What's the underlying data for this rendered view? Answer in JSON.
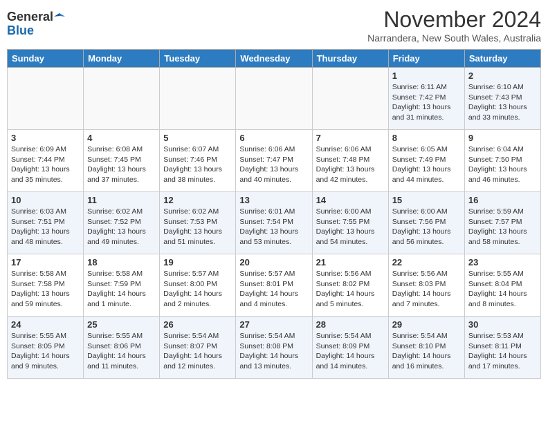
{
  "header": {
    "logo_general": "General",
    "logo_blue": "Blue",
    "month_title": "November 2024",
    "subtitle": "Narrandera, New South Wales, Australia"
  },
  "days_of_week": [
    "Sunday",
    "Monday",
    "Tuesday",
    "Wednesday",
    "Thursday",
    "Friday",
    "Saturday"
  ],
  "weeks": [
    [
      {
        "num": "",
        "detail": ""
      },
      {
        "num": "",
        "detail": ""
      },
      {
        "num": "",
        "detail": ""
      },
      {
        "num": "",
        "detail": ""
      },
      {
        "num": "",
        "detail": ""
      },
      {
        "num": "1",
        "detail": "Sunrise: 6:11 AM\nSunset: 7:42 PM\nDaylight: 13 hours\nand 31 minutes."
      },
      {
        "num": "2",
        "detail": "Sunrise: 6:10 AM\nSunset: 7:43 PM\nDaylight: 13 hours\nand 33 minutes."
      }
    ],
    [
      {
        "num": "3",
        "detail": "Sunrise: 6:09 AM\nSunset: 7:44 PM\nDaylight: 13 hours\nand 35 minutes."
      },
      {
        "num": "4",
        "detail": "Sunrise: 6:08 AM\nSunset: 7:45 PM\nDaylight: 13 hours\nand 37 minutes."
      },
      {
        "num": "5",
        "detail": "Sunrise: 6:07 AM\nSunset: 7:46 PM\nDaylight: 13 hours\nand 38 minutes."
      },
      {
        "num": "6",
        "detail": "Sunrise: 6:06 AM\nSunset: 7:47 PM\nDaylight: 13 hours\nand 40 minutes."
      },
      {
        "num": "7",
        "detail": "Sunrise: 6:06 AM\nSunset: 7:48 PM\nDaylight: 13 hours\nand 42 minutes."
      },
      {
        "num": "8",
        "detail": "Sunrise: 6:05 AM\nSunset: 7:49 PM\nDaylight: 13 hours\nand 44 minutes."
      },
      {
        "num": "9",
        "detail": "Sunrise: 6:04 AM\nSunset: 7:50 PM\nDaylight: 13 hours\nand 46 minutes."
      }
    ],
    [
      {
        "num": "10",
        "detail": "Sunrise: 6:03 AM\nSunset: 7:51 PM\nDaylight: 13 hours\nand 48 minutes."
      },
      {
        "num": "11",
        "detail": "Sunrise: 6:02 AM\nSunset: 7:52 PM\nDaylight: 13 hours\nand 49 minutes."
      },
      {
        "num": "12",
        "detail": "Sunrise: 6:02 AM\nSunset: 7:53 PM\nDaylight: 13 hours\nand 51 minutes."
      },
      {
        "num": "13",
        "detail": "Sunrise: 6:01 AM\nSunset: 7:54 PM\nDaylight: 13 hours\nand 53 minutes."
      },
      {
        "num": "14",
        "detail": "Sunrise: 6:00 AM\nSunset: 7:55 PM\nDaylight: 13 hours\nand 54 minutes."
      },
      {
        "num": "15",
        "detail": "Sunrise: 6:00 AM\nSunset: 7:56 PM\nDaylight: 13 hours\nand 56 minutes."
      },
      {
        "num": "16",
        "detail": "Sunrise: 5:59 AM\nSunset: 7:57 PM\nDaylight: 13 hours\nand 58 minutes."
      }
    ],
    [
      {
        "num": "17",
        "detail": "Sunrise: 5:58 AM\nSunset: 7:58 PM\nDaylight: 13 hours\nand 59 minutes."
      },
      {
        "num": "18",
        "detail": "Sunrise: 5:58 AM\nSunset: 7:59 PM\nDaylight: 14 hours\nand 1 minute."
      },
      {
        "num": "19",
        "detail": "Sunrise: 5:57 AM\nSunset: 8:00 PM\nDaylight: 14 hours\nand 2 minutes."
      },
      {
        "num": "20",
        "detail": "Sunrise: 5:57 AM\nSunset: 8:01 PM\nDaylight: 14 hours\nand 4 minutes."
      },
      {
        "num": "21",
        "detail": "Sunrise: 5:56 AM\nSunset: 8:02 PM\nDaylight: 14 hours\nand 5 minutes."
      },
      {
        "num": "22",
        "detail": "Sunrise: 5:56 AM\nSunset: 8:03 PM\nDaylight: 14 hours\nand 7 minutes."
      },
      {
        "num": "23",
        "detail": "Sunrise: 5:55 AM\nSunset: 8:04 PM\nDaylight: 14 hours\nand 8 minutes."
      }
    ],
    [
      {
        "num": "24",
        "detail": "Sunrise: 5:55 AM\nSunset: 8:05 PM\nDaylight: 14 hours\nand 9 minutes."
      },
      {
        "num": "25",
        "detail": "Sunrise: 5:55 AM\nSunset: 8:06 PM\nDaylight: 14 hours\nand 11 minutes."
      },
      {
        "num": "26",
        "detail": "Sunrise: 5:54 AM\nSunset: 8:07 PM\nDaylight: 14 hours\nand 12 minutes."
      },
      {
        "num": "27",
        "detail": "Sunrise: 5:54 AM\nSunset: 8:08 PM\nDaylight: 14 hours\nand 13 minutes."
      },
      {
        "num": "28",
        "detail": "Sunrise: 5:54 AM\nSunset: 8:09 PM\nDaylight: 14 hours\nand 14 minutes."
      },
      {
        "num": "29",
        "detail": "Sunrise: 5:54 AM\nSunset: 8:10 PM\nDaylight: 14 hours\nand 16 minutes."
      },
      {
        "num": "30",
        "detail": "Sunrise: 5:53 AM\nSunset: 8:11 PM\nDaylight: 14 hours\nand 17 minutes."
      }
    ]
  ]
}
